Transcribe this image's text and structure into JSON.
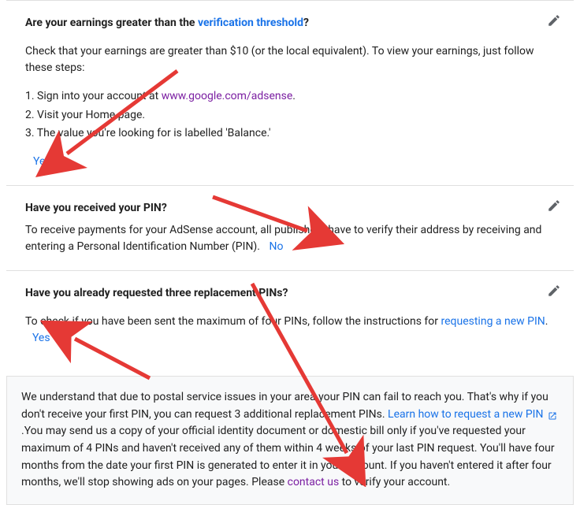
{
  "section1": {
    "title_pre": "Are your earnings greater than the ",
    "title_link": "verification threshold",
    "title_post": "?",
    "desc": "Check that your earnings are greater than $10 (or the local equivalent). To view your earnings, just follow these steps:",
    "step1_pre": "1. Sign into your account at ",
    "step1_link": "www.google.com/adsense",
    "step1_post": ".",
    "step2": "2. Visit your Home page.",
    "step3": "3. The value you're looking for is labelled 'Balance.'",
    "answer": "Yes"
  },
  "section2": {
    "title": "Have you received your PIN?",
    "desc": "To receive payments for your AdSense account, all publishers have to verify their address by receiving and entering a Personal Identification Number (PIN).",
    "answer": "No"
  },
  "section3": {
    "title": "Have you already requested three replacement PINs?",
    "desc_pre": "To check if you have been sent the maximum of four PINs, follow the instructions for ",
    "desc_link": "requesting a new PIN",
    "desc_post": ".",
    "answer": "Yes"
  },
  "infobox": {
    "t1": "We understand that due to postal service issues in your area your PIN can fail to reach you. That's why if you don't receive your first PIN, you can request 3 additional replacement PINs. ",
    "link1": "Learn how to request a new PIN",
    "t2": " .You may send us a copy of your official identity document or domestic bill only if you've requested your maximum of 4 PINs and haven't received any of them within 4 weeks of your last PIN request. You'll have four months from the date your first PIN is generated to enter it in your account. If you haven't entered it after four months, we'll stop showing ads on your pages. Please ",
    "link2": "contact us",
    "t3": " to verify your account."
  }
}
